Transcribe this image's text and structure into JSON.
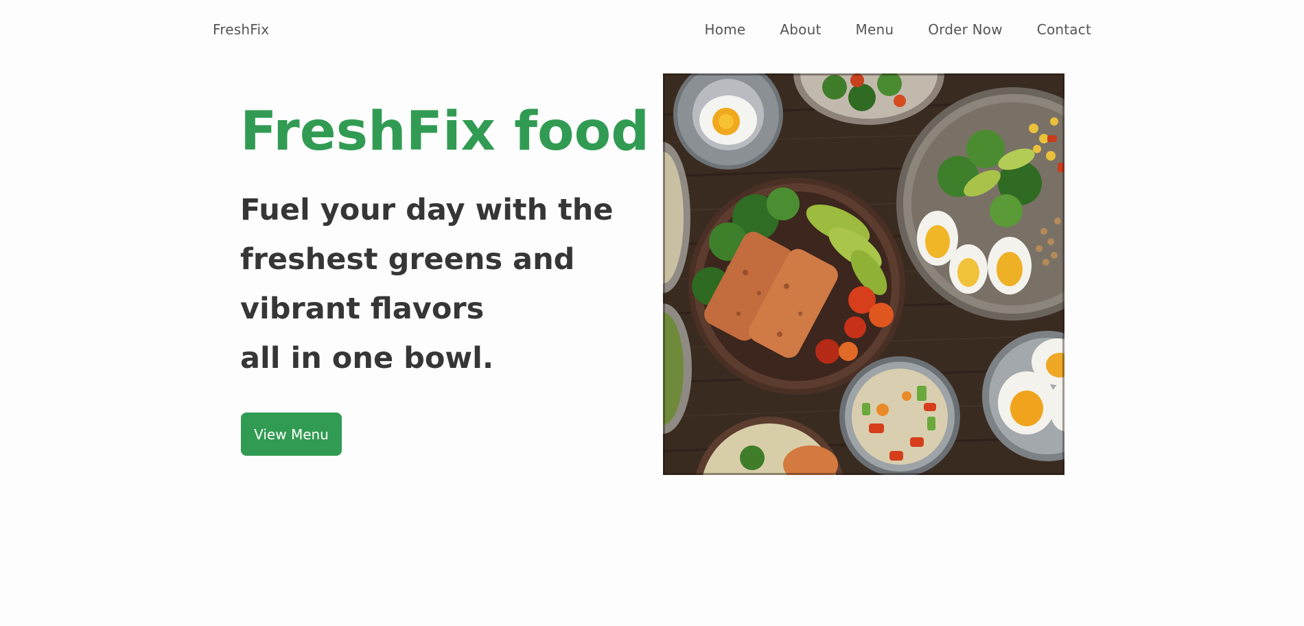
{
  "header": {
    "logo": "FreshFix",
    "nav": [
      {
        "label": "Home"
      },
      {
        "label": "About"
      },
      {
        "label": "Menu"
      },
      {
        "label": "Order Now"
      },
      {
        "label": "Contact"
      }
    ]
  },
  "hero": {
    "title": "FreshFix food",
    "tagline_lines": [
      "Fuel your day with the",
      "freshest greens and",
      "vibrant flavors",
      "all in one bowl."
    ],
    "cta_label": "View Menu"
  },
  "colors": {
    "brand_green": "#329b53",
    "heading_dark": "#363636",
    "nav_text": "#555555",
    "background": "#fdfdfd"
  },
  "image": {
    "subject": "food-bowls-photo"
  }
}
